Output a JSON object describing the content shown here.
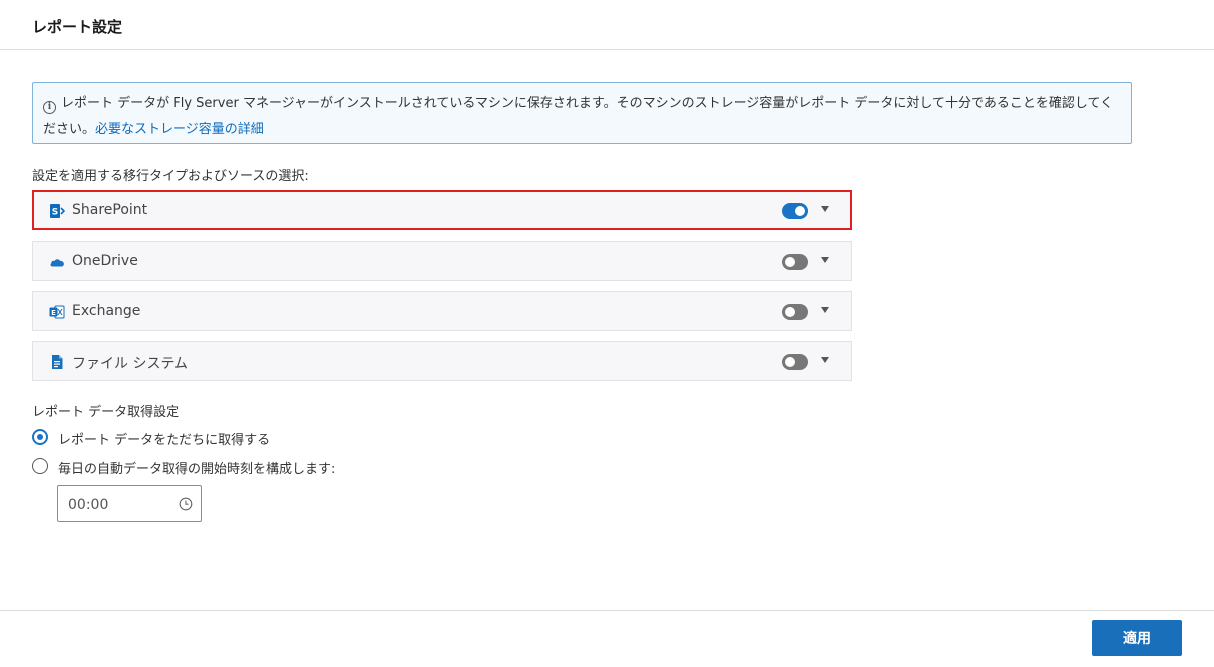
{
  "header": {
    "title": "レポート設定"
  },
  "info": {
    "message": "レポート データが Fly Server マネージャーがインストールされているマシンに保存されます。そのマシンのストレージ容量がレポート データに対して十分であることを確認してください。",
    "link": "必要なストレージ容量の詳細"
  },
  "sources": {
    "label": "設定を適用する移行タイプおよびソースの選択:",
    "items": [
      {
        "label": "SharePoint",
        "enabled": true,
        "icon": "sharepoint-icon",
        "selected": true
      },
      {
        "label": "OneDrive",
        "enabled": false,
        "icon": "onedrive-icon"
      },
      {
        "label": "Exchange",
        "enabled": false,
        "icon": "exchange-icon"
      },
      {
        "label": "ファイル システム",
        "enabled": false,
        "icon": "file-system-icon"
      }
    ]
  },
  "retrieval": {
    "label": "レポート データ取得設定",
    "options": [
      {
        "label": "レポート データをただちに取得する",
        "checked": true
      },
      {
        "label": "毎日の自動データ取得の開始時刻を構成します:",
        "checked": false
      }
    ],
    "time_value": "00:00"
  },
  "footer": {
    "apply_label": "適用"
  },
  "colors": {
    "accent": "#1a6fba",
    "toggle_on": "#1a73c4",
    "highlight": "#e02020"
  }
}
